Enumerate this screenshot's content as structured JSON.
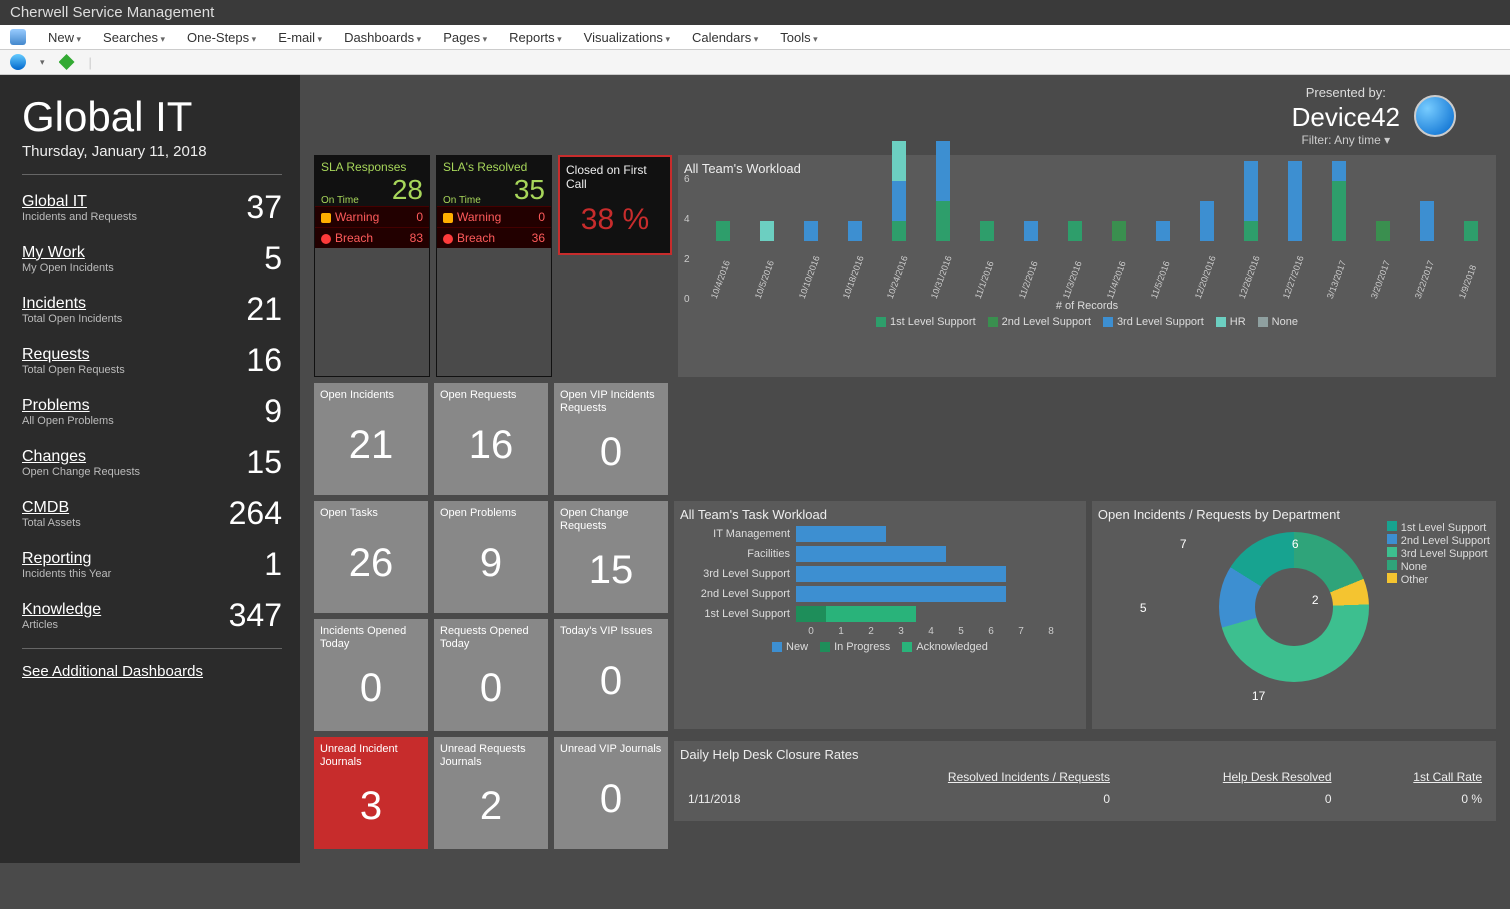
{
  "app_title": "Cherwell Service Management",
  "menu": [
    "New",
    "Searches",
    "One-Steps",
    "E-mail",
    "Dashboards",
    "Pages",
    "Reports",
    "Visualizations",
    "Calendars",
    "Tools"
  ],
  "sidebar": {
    "title": "Global IT",
    "date": "Thursday, January 11, 2018",
    "items": [
      {
        "label": "Global IT",
        "sub": "Incidents and Requests",
        "val": "37"
      },
      {
        "label": "My Work",
        "sub": "My Open Incidents",
        "val": "5"
      },
      {
        "label": "Incidents",
        "sub": "Total Open Incidents",
        "val": "21"
      },
      {
        "label": "Requests",
        "sub": "Total Open Requests",
        "val": "16"
      },
      {
        "label": "Problems",
        "sub": "All Open Problems",
        "val": "9"
      },
      {
        "label": "Changes",
        "sub": "Open Change Requests",
        "val": "15"
      },
      {
        "label": "CMDB",
        "sub": "Total Assets",
        "val": "264"
      },
      {
        "label": "Reporting",
        "sub": "Incidents this Year",
        "val": "1"
      },
      {
        "label": "Knowledge",
        "sub": "Articles",
        "val": "347"
      }
    ],
    "see_all": "See Additional Dashboards"
  },
  "header": {
    "presented": "Presented by:",
    "brand": "Device42",
    "filter": "Filter: Any time"
  },
  "sla_resp": {
    "title": "SLA Responses",
    "ontime": "On Time",
    "big": "28",
    "warn_l": "Warning",
    "warn_v": "0",
    "breach_l": "Breach",
    "breach_v": "83"
  },
  "sla_res": {
    "title": "SLA's Resolved",
    "ontime": "On Time",
    "big": "35",
    "warn_l": "Warning",
    "warn_v": "0",
    "breach_l": "Breach",
    "breach_v": "36"
  },
  "closed": {
    "title": "Closed on First Call",
    "val": "38 %"
  },
  "tiles": {
    "r1": [
      [
        "Open Incidents",
        "21"
      ],
      [
        "Open Requests",
        "16"
      ],
      [
        "Open VIP Incidents Requests",
        "0"
      ]
    ],
    "r2": [
      [
        "Open Tasks",
        "26"
      ],
      [
        "Open Problems",
        "9"
      ],
      [
        "Open Change Requests",
        "15"
      ]
    ],
    "r3": [
      [
        "Incidents Opened Today",
        "0"
      ],
      [
        "Requests Opened Today",
        "0"
      ],
      [
        "Today's VIP Issues",
        "0"
      ]
    ],
    "r4": [
      [
        "Unread Incident Journals",
        "3",
        "red"
      ],
      [
        "Unread Requests Journals",
        "2"
      ],
      [
        "Unread VIP Journals",
        "0"
      ]
    ]
  },
  "closure": {
    "title": "Daily Help Desk Closure Rates",
    "cols": [
      "",
      "Resolved Incidents / Requests",
      "Help Desk Resolved",
      "1st Call Rate"
    ],
    "row": [
      "1/11/2018",
      "0",
      "0",
      "0 %"
    ]
  },
  "charts": {
    "workload_title": "All Team's Workload",
    "workload_xaxis": "# of Records",
    "workload_legend": [
      "1st Level Support",
      "2nd Level Support",
      "3rd Level Support",
      "HR",
      "None"
    ],
    "task_title": "All Team's Task Workload",
    "task_legend": [
      "New",
      "In Progress",
      "Acknowledged"
    ],
    "dept_title": "Open Incidents / Requests by Department",
    "dept_legend": [
      "1st Level Support",
      "2nd Level Support",
      "3rd Level Support",
      "None",
      "Other"
    ],
    "dept_vals": {
      "a": "7",
      "b": "6",
      "c": "2",
      "d": "17",
      "e": "5"
    }
  },
  "chart_data": [
    {
      "type": "bar",
      "title": "All Team's Workload",
      "ylabel": "",
      "xlabel": "# of Records",
      "ylim": [
        0,
        6
      ],
      "categories": [
        "10/4/2016",
        "10/5/2016",
        "10/10/2016",
        "10/18/2016",
        "10/24/2016",
        "10/31/2016",
        "11/1/2016",
        "11/2/2016",
        "11/3/2016",
        "11/4/2016",
        "11/5/2016",
        "12/20/2016",
        "12/26/2016",
        "12/27/2016",
        "3/13/2017",
        "3/20/2017",
        "3/22/2017",
        "1/9/2018"
      ],
      "series": [
        {
          "name": "1st Level Support",
          "color": "#2e9e6b",
          "values": [
            1,
            0,
            0,
            0,
            1,
            2,
            1,
            0,
            1,
            0,
            0,
            0,
            1,
            0,
            3,
            0,
            0,
            1
          ]
        },
        {
          "name": "2nd Level Support",
          "color": "#3a8f4f",
          "values": [
            0,
            0,
            0,
            0,
            0,
            0,
            0,
            0,
            0,
            1,
            0,
            0,
            0,
            0,
            0,
            1,
            0,
            0
          ]
        },
        {
          "name": "3rd Level Support",
          "color": "#3d8fd1",
          "values": [
            0,
            0,
            1,
            1,
            2,
            3,
            0,
            1,
            0,
            0,
            1,
            2,
            3,
            4,
            1,
            0,
            2,
            0
          ]
        },
        {
          "name": "HR",
          "color": "#6ccfc1",
          "values": [
            0,
            1,
            0,
            0,
            2,
            0,
            0,
            0,
            0,
            0,
            0,
            0,
            0,
            0,
            0,
            0,
            0,
            0
          ]
        },
        {
          "name": "None",
          "color": "#8fa0a0",
          "values": [
            0,
            0,
            0,
            0,
            0,
            0,
            0,
            0,
            0,
            0,
            0,
            0,
            0,
            0,
            0,
            0,
            0,
            0
          ]
        }
      ]
    },
    {
      "type": "bar",
      "orientation": "h",
      "title": "All Team's Task Workload",
      "xlim": [
        0,
        8
      ],
      "categories": [
        "IT Management",
        "Facilities",
        "3rd Level Support",
        "2nd Level Support",
        "1st Level Support"
      ],
      "series": [
        {
          "name": "New",
          "color": "#3d8fd1",
          "values": [
            3,
            5,
            7,
            7,
            0
          ]
        },
        {
          "name": "In Progress",
          "color": "#1e8e5a",
          "values": [
            0,
            0,
            0,
            0,
            1
          ]
        },
        {
          "name": "Acknowledged",
          "color": "#29b37a",
          "values": [
            0,
            0,
            0,
            0,
            3
          ]
        }
      ]
    },
    {
      "type": "pie",
      "title": "Open Incidents / Requests by Department",
      "series": [
        {
          "name": "1st Level Support",
          "value": 7,
          "color": "#17a390"
        },
        {
          "name": "2nd Level Support",
          "value": 5,
          "color": "#3d8fd1"
        },
        {
          "name": "3rd Level Support",
          "value": 17,
          "color": "#3dbf8f"
        },
        {
          "name": "None",
          "value": 6,
          "color": "#2fa47a"
        },
        {
          "name": "Other",
          "value": 2,
          "color": "#f4c430"
        }
      ]
    }
  ]
}
